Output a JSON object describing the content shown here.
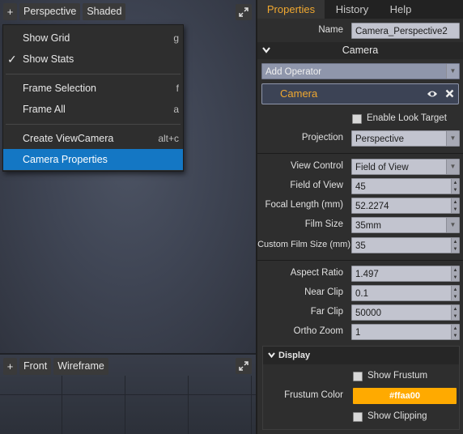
{
  "viewport_top": {
    "toolbar": {
      "add": "+",
      "view": "Perspective",
      "shading": "Shaded"
    },
    "expand_icon": "expand-icon"
  },
  "context_menu": {
    "items": [
      {
        "label": "Show Grid",
        "shortcut": "g",
        "checked": false
      },
      {
        "label": "Show Stats",
        "shortcut": "",
        "checked": true,
        "check_glyph": "✓"
      },
      {
        "label": "Frame Selection",
        "shortcut": "f"
      },
      {
        "label": "Frame All",
        "shortcut": "a"
      },
      {
        "label": "Create ViewCamera",
        "shortcut": "alt+c"
      },
      {
        "label": "Camera Properties",
        "shortcut": "",
        "highlighted": true
      }
    ]
  },
  "viewport_bottom": {
    "toolbar": {
      "add": "+",
      "view": "Front",
      "shading": "Wireframe"
    }
  },
  "panel": {
    "tabs": [
      {
        "label": "Properties",
        "active": true
      },
      {
        "label": "History",
        "active": false
      },
      {
        "label": "Help",
        "active": false
      }
    ],
    "name_label": "Name",
    "name_value": "Camera_Perspective2",
    "camera_section": {
      "title": "Camera",
      "collapse_glyph": "❯"
    },
    "add_operator": "Add Operator",
    "operator": {
      "name": "Camera",
      "eye_icon": "eye-icon",
      "remove_icon": "close-icon"
    },
    "enable_look_target": {
      "label": "Enable Look Target",
      "checked": false
    },
    "projection": {
      "label": "Projection",
      "value": "Perspective"
    },
    "view_control": {
      "label": "View Control",
      "value": "Field of View"
    },
    "field_of_view": {
      "label": "Field of View",
      "value": "45"
    },
    "focal_length": {
      "label": "Focal Length (mm)",
      "value": "52.2274"
    },
    "film_size": {
      "label": "Film Size",
      "value": "35mm"
    },
    "custom_film_size": {
      "label": "Custom Film Size (mm)",
      "value": "35"
    },
    "aspect_ratio": {
      "label": "Aspect Ratio",
      "value": "1.497"
    },
    "near_clip": {
      "label": "Near Clip",
      "value": "0.1"
    },
    "far_clip": {
      "label": "Far Clip",
      "value": "50000"
    },
    "ortho_zoom": {
      "label": "Ortho Zoom",
      "value": "1"
    },
    "display": {
      "title": "Display",
      "show_frustum": {
        "label": "Show Frustum",
        "checked": false
      },
      "frustum_color": {
        "label": "Frustum Color",
        "value": "#ffaa00"
      },
      "show_clipping": {
        "label": "Show Clipping",
        "checked": false
      }
    }
  },
  "colors": {
    "accent_tab": "#f0a830",
    "menu_highlight": "#1477c4",
    "frustum_color": "#ffaa00",
    "operator_name": "#f0a830"
  }
}
